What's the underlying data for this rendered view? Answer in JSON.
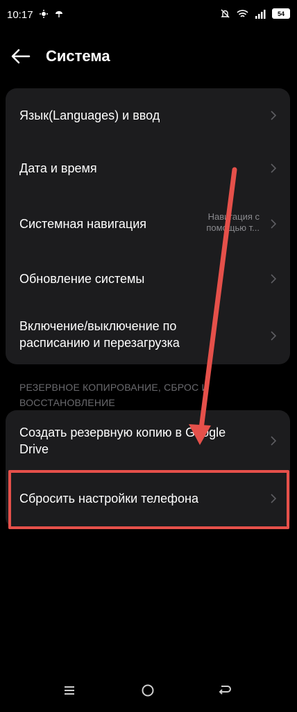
{
  "status_bar": {
    "time": "10:17",
    "battery": "54",
    "icons": [
      "notification-icon",
      "weather-icon",
      "mute-icon",
      "wifi-icon",
      "signal-icon",
      "battery-icon"
    ]
  },
  "header": {
    "title": "Система"
  },
  "system_items": [
    {
      "label": "Язык(Languages) и ввод",
      "value": ""
    },
    {
      "label": "Дата и время",
      "value": ""
    },
    {
      "label": "Системная навигация",
      "value": "Навигация с помощью т..."
    },
    {
      "label": "Обновление системы",
      "value": ""
    },
    {
      "label": "Включение/выключение по расписанию и перезагрузка",
      "value": ""
    }
  ],
  "backup_section": {
    "label": "РЕЗЕРВНОЕ КОПИРОВАНИЕ, СБРОС И ВОССТАНОВЛЕНИЕ",
    "items": [
      {
        "label": "Создать резервную копию в Google Drive"
      },
      {
        "label": "Сбросить настройки телефона"
      }
    ]
  },
  "annotation": {
    "color": "#e5504a"
  },
  "colors": {
    "background": "#000000",
    "card": "#1c1c1e",
    "secondary_text": "#8a8a8e"
  }
}
